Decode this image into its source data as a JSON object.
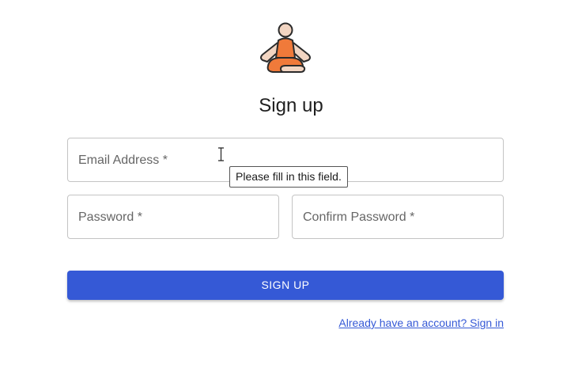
{
  "logo": {
    "icon": "meditation-person-icon"
  },
  "title": "Sign up",
  "form": {
    "email": {
      "label": "Email Address *",
      "value": ""
    },
    "password": {
      "label": "Password *",
      "value": ""
    },
    "confirm_password": {
      "label": "Confirm Password *",
      "value": ""
    }
  },
  "tooltip": "Please fill in this field.",
  "signup_button": "SIGN UP",
  "signin_link": "Already have an account? Sign in",
  "colors": {
    "accent": "#3559d6",
    "logo_orange": "#f07a3a",
    "logo_skin": "#f2d5c2",
    "outline": "#2b2b2b"
  }
}
